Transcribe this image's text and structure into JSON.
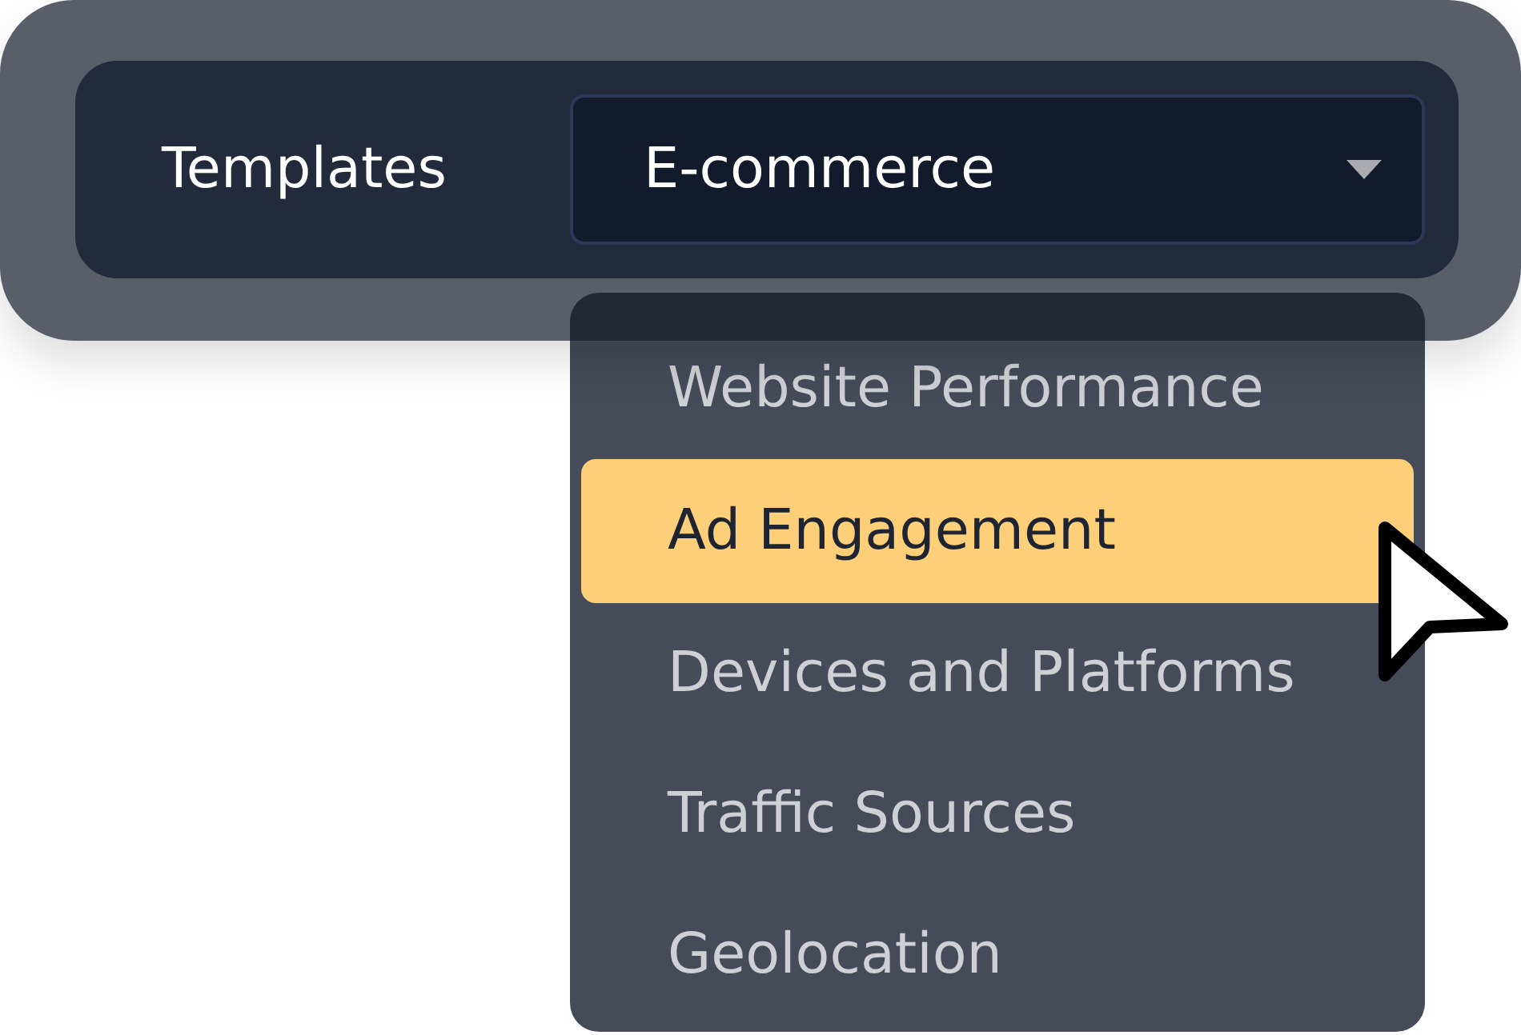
{
  "template_bar": {
    "label": "Templates",
    "select": {
      "value": "E-commerce",
      "expanded": true
    }
  },
  "options": [
    {
      "label": "Website Performance",
      "selected": false
    },
    {
      "label": "Ad Engagement",
      "selected": true
    },
    {
      "label": "Devices and Platforms",
      "selected": false
    },
    {
      "label": "Traffic Sources",
      "selected": false
    },
    {
      "label": "Geolocation",
      "selected": false
    }
  ]
}
